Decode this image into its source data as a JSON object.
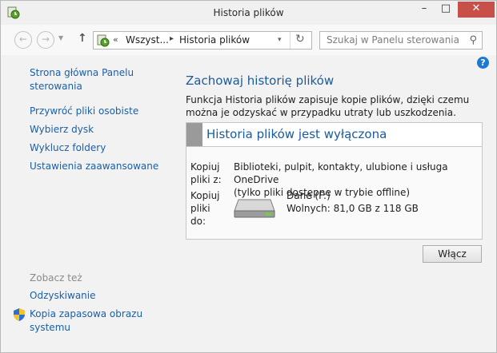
{
  "window": {
    "title": "Historia plików"
  },
  "address": {
    "overflow": "«",
    "crumb1": "Wszyst...",
    "separator": "▸",
    "crumb2": "Historia plików"
  },
  "search": {
    "placeholder": "Szukaj w Panelu sterowania"
  },
  "sidebar": {
    "home": [
      "Strona główna Panelu",
      "sterowania"
    ],
    "links": [
      "Przywróć pliki osobiste",
      "Wybierz dysk",
      "Wyklucz foldery",
      "Ustawienia zaawansowane"
    ],
    "see_also": "Zobacz też",
    "recovery": "Odzyskiwanie",
    "backup": [
      "Kopia zapasowa obrazu",
      "systemu"
    ]
  },
  "main": {
    "heading": "Zachowaj historię plików",
    "description": "Funkcja Historia plików zapisuje kopie plików, dzięki czemu można je odzyskać w przypadku utraty lub uszkodzenia.",
    "panel": {
      "title": "Historia plików jest wyłączona",
      "copy_from_label": [
        "Kopiuj",
        "pliki z:"
      ],
      "copy_from_value": [
        "Biblioteki, pulpit, kontakty, ulubione i usługa OneDrive",
        "(tylko pliki dostępne w trybie offline)"
      ],
      "copy_to_label": [
        "Kopiuj",
        "pliki",
        "do:"
      ],
      "drive_name": "Dane (F:)",
      "drive_free": "Wolnych: 81,0 GB z  118 GB"
    },
    "enable_button": "Włącz"
  },
  "icons": [
    "file-history-icon",
    "back-arrow-icon",
    "forward-arrow-icon",
    "recent-dropdown-icon",
    "up-arrow-icon",
    "refresh-icon",
    "search-icon",
    "help-icon",
    "drive-icon",
    "shield-icon"
  ]
}
